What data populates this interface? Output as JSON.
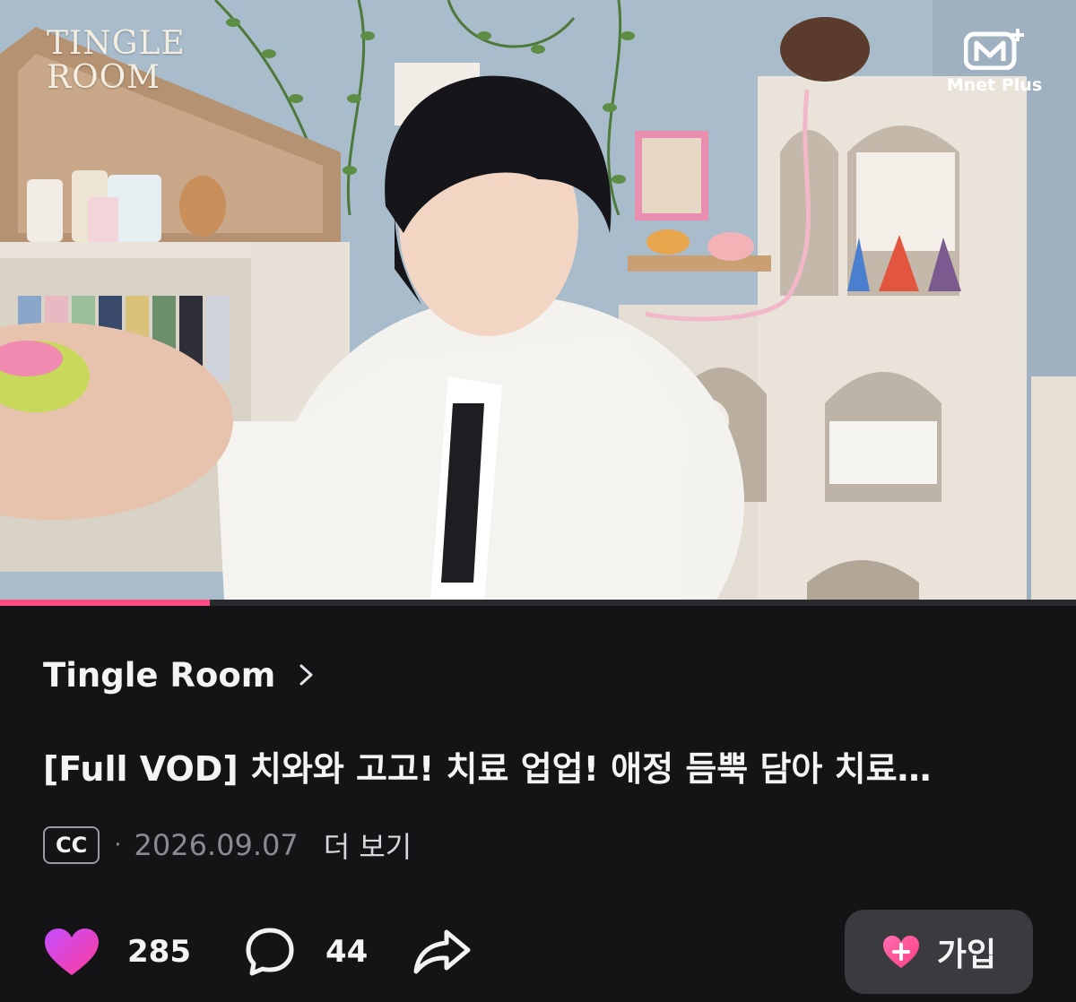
{
  "video": {
    "brand_logo_line1": "TINGLE",
    "brand_logo_line2": "ROOM",
    "platform_logo_mark": "M+",
    "platform_name": "Mnet Plus",
    "progress_fraction": 0.195
  },
  "channel": {
    "name": "Tingle Room"
  },
  "post": {
    "title": "[Full VOD] 치와와 고고! 치료 업업! 애정 듬뿍 담아 치료…",
    "cc_badge": "CC",
    "separator": "·",
    "date": "2026.09.07",
    "more_label": "더 보기"
  },
  "actions": {
    "like_count": "285",
    "comment_count": "44",
    "join_label": "가입"
  },
  "icons": {
    "chevron": "chevron-right-icon",
    "like": "heart-icon",
    "comment": "speech-bubble-icon",
    "share": "share-arrow-icon",
    "join": "heart-plus-icon"
  },
  "colors": {
    "background": "#141417",
    "progress": "#ff4d83",
    "heart_gradient_start": "#c44dff",
    "heart_gradient_end": "#ff3d9a",
    "join_button": "#3a3a3f"
  }
}
